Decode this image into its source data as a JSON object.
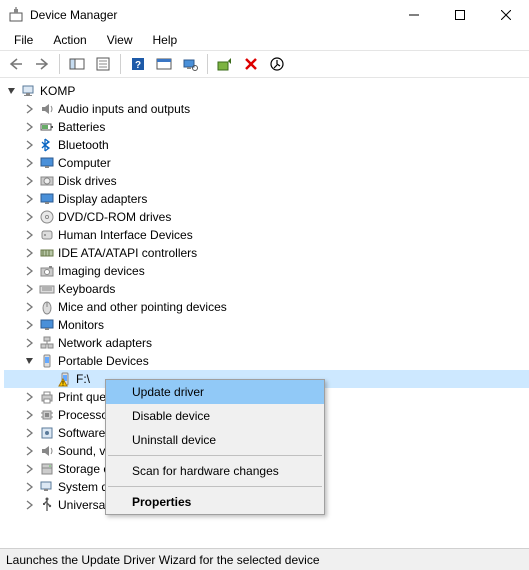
{
  "window": {
    "title": "Device Manager"
  },
  "menubar": [
    "File",
    "Action",
    "View",
    "Help"
  ],
  "tree": {
    "root": "KOMP",
    "nodes": [
      {
        "label": "Audio inputs and outputs",
        "icon": "speaker"
      },
      {
        "label": "Batteries",
        "icon": "battery"
      },
      {
        "label": "Bluetooth",
        "icon": "bluetooth"
      },
      {
        "label": "Computer",
        "icon": "monitor"
      },
      {
        "label": "Disk drives",
        "icon": "disk"
      },
      {
        "label": "Display adapters",
        "icon": "monitor"
      },
      {
        "label": "DVD/CD-ROM drives",
        "icon": "cd"
      },
      {
        "label": "Human Interface Devices",
        "icon": "hid"
      },
      {
        "label": "IDE ATA/ATAPI controllers",
        "icon": "ide"
      },
      {
        "label": "Imaging devices",
        "icon": "camera"
      },
      {
        "label": "Keyboards",
        "icon": "keyboard"
      },
      {
        "label": "Mice and other pointing devices",
        "icon": "mouse"
      },
      {
        "label": "Monitors",
        "icon": "monitor"
      },
      {
        "label": "Network adapters",
        "icon": "network"
      },
      {
        "label": "Portable Devices",
        "icon": "portable",
        "expanded": true,
        "children": [
          {
            "label": "F:\\",
            "icon": "portable-warn",
            "selected": true
          }
        ]
      },
      {
        "label": "Print queues",
        "icon": "printer"
      },
      {
        "label": "Processors",
        "icon": "cpu"
      },
      {
        "label": "Software devices",
        "icon": "software"
      },
      {
        "label": "Sound, video and game controllers",
        "icon": "speaker"
      },
      {
        "label": "Storage controllers",
        "icon": "storage"
      },
      {
        "label": "System devices",
        "icon": "system"
      },
      {
        "label": "Universal Serial Bus controllers",
        "icon": "usb"
      }
    ]
  },
  "context_menu": {
    "items": [
      {
        "label": "Update driver",
        "highlight": true
      },
      {
        "label": "Disable device"
      },
      {
        "label": "Uninstall device"
      },
      {
        "sep": true
      },
      {
        "label": "Scan for hardware changes"
      },
      {
        "sep": true
      },
      {
        "label": "Properties",
        "bold": true
      }
    ]
  },
  "statusbar": "Launches the Update Driver Wizard for the selected device"
}
